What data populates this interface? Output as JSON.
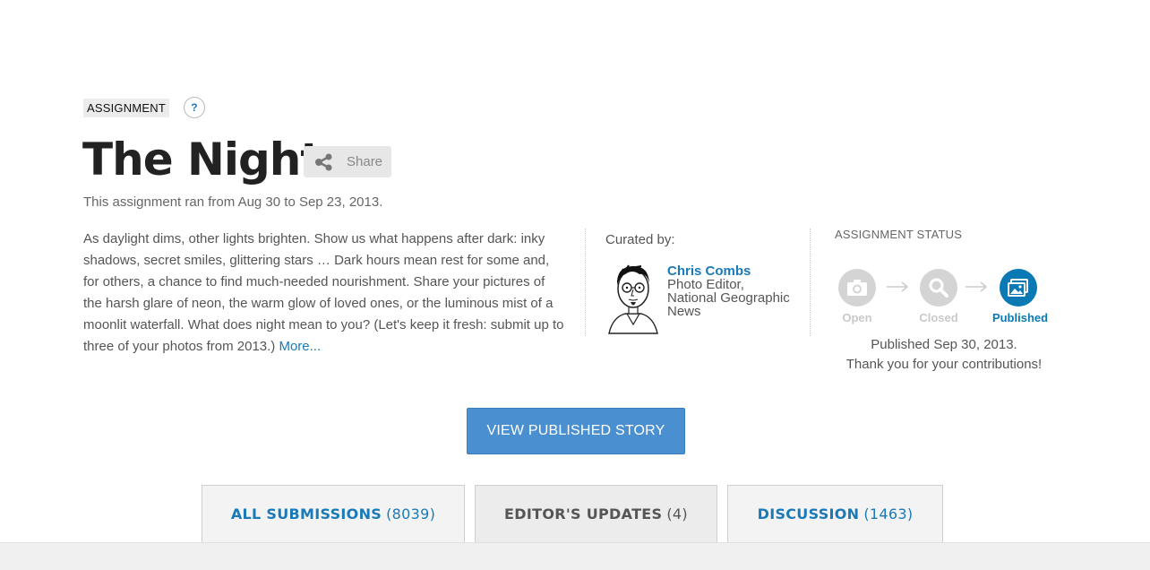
{
  "assignment": {
    "tag_label": "ASSIGNMENT",
    "help_label": "?",
    "title": "The Night",
    "share_label": "Share",
    "ran_text": "This assignment ran from Aug 30 to Sep 23, 2013.",
    "description": "As daylight dims, other lights brighten. Show us what happens after dark: inky shadows, secret smiles, glittering stars … Dark hours mean rest for some and, for others, a chance to find much-needed nourishment. Share your pictures of the harsh glare of neon, the warm glow of loved ones, or the luminous mist of a moonlit waterfall. What does night mean to you? (Let's keep it fresh: submit up to three of your photos from 2013.)",
    "more_link": "More..."
  },
  "curator": {
    "label": "Curated by:",
    "name": "Chris Combs",
    "role": "Photo Editor, National Geographic News"
  },
  "status": {
    "label": "ASSIGNMENT STATUS",
    "steps": [
      {
        "label": "Open",
        "icon": "camera-icon",
        "active": false
      },
      {
        "label": "Closed",
        "icon": "magnifier-icon",
        "active": false
      },
      {
        "label": "Published",
        "icon": "photos-icon",
        "active": true
      }
    ],
    "published_date": "Published Sep 30, 2013.",
    "thanks": "Thank you for your contributions!"
  },
  "cta": {
    "label": "VIEW PUBLISHED STORY"
  },
  "tabs": [
    {
      "label": "ALL SUBMISSIONS",
      "count": "(8039)",
      "active": false
    },
    {
      "label": "EDITOR'S UPDATES",
      "count": "(4)",
      "active": true
    },
    {
      "label": "DISCUSSION",
      "count": "(1463)",
      "active": false
    }
  ],
  "colors": {
    "accent": "#1a7ab8",
    "button": "#4a8fd0",
    "status_active": "#0a79b4",
    "status_inactive": "#d4d4d4"
  }
}
